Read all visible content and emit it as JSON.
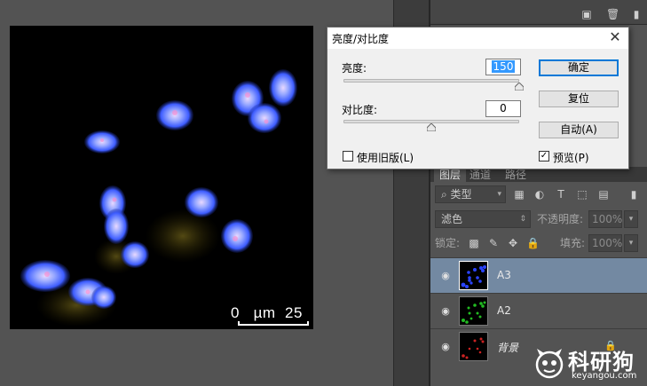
{
  "canvas": {
    "scalebar": "0   µm  25"
  },
  "dialog": {
    "title": "亮度/对比度",
    "brightness_label": "亮度:",
    "brightness_value": "150",
    "brightness_level": 1.0,
    "contrast_label": "对比度:",
    "contrast_value": "0",
    "contrast_level": 0.5,
    "ok_label": "确定",
    "reset_label": "复位",
    "auto_label": "自动(A)",
    "legacy_label": "使用旧版(L)",
    "legacy_checked": false,
    "preview_label": "预览(P)",
    "preview_checked": true
  },
  "layers_panel": {
    "tabs": [
      "图层",
      "通道",
      "路径"
    ],
    "filter_kind": "类型",
    "blend_mode": "滤色",
    "opacity_label": "不透明度:",
    "opacity_value": "100%",
    "lock_label": "锁定:",
    "fill_label": "填充:",
    "fill_value": "100%",
    "layers": [
      {
        "name": "A3",
        "selected": true,
        "color": "#2a44ff"
      },
      {
        "name": "A2",
        "selected": false,
        "color": "#22bb22"
      },
      {
        "name": "背景",
        "selected": false,
        "color": "#cc2222",
        "locked": true
      }
    ]
  },
  "watermark": {
    "brand": "科研狗",
    "url": "keyangou.com"
  },
  "colors": {
    "accent": "#0078d7",
    "selected_layer": "#7389a2",
    "panel_bg": "#535353"
  }
}
